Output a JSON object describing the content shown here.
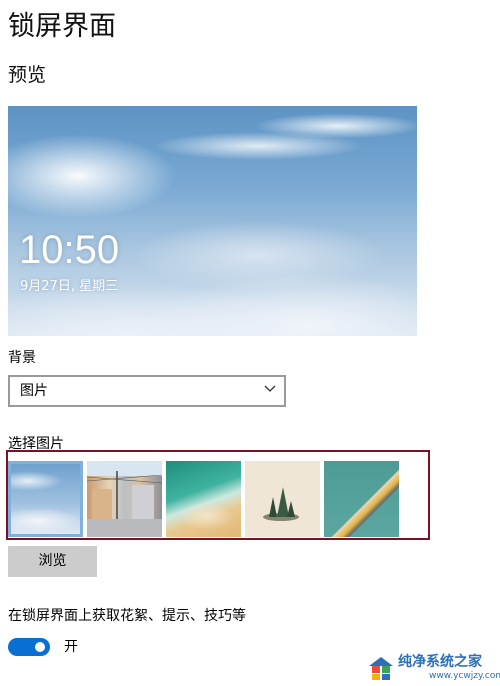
{
  "page": {
    "title": "锁屏界面"
  },
  "preview": {
    "heading": "预览",
    "time": "10:50",
    "date": "9月27日, 星期三"
  },
  "background": {
    "label": "背景",
    "selected": "图片",
    "chevron_icon": "chevron-down-icon"
  },
  "choose_picture": {
    "label": "选择图片",
    "thumbnails": [
      {
        "name": "clouds",
        "selected": true
      },
      {
        "name": "street"
      },
      {
        "name": "beach-waves"
      },
      {
        "name": "pine-island"
      },
      {
        "name": "pier-aerial"
      }
    ],
    "highlight_color": "#7a1225"
  },
  "browse": {
    "label": "浏览"
  },
  "tips": {
    "text": "在锁屏界面上获取花絮、提示、技巧等",
    "toggle_on": true,
    "toggle_label": "开"
  },
  "watermark": {
    "name": "纯净系统之家",
    "url": "www.ycwjzy.com"
  },
  "colors": {
    "accent": "#0a6fd3",
    "button_bg": "#cccccc"
  }
}
